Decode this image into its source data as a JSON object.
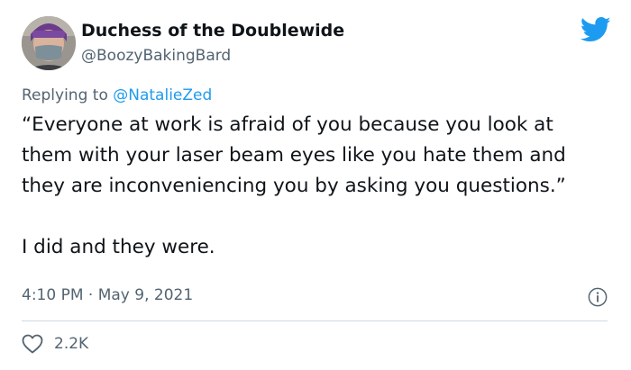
{
  "author": {
    "name": "Duchess of the Doublewide",
    "handle": "@BoozyBakingBard",
    "avatar_icon": "profile-photo"
  },
  "reply": {
    "prefix": "Replying to ",
    "to": "@NatalieZed"
  },
  "text": {
    "line1": "“Everyone at work is afraid of you because you look at them with your laser beam eyes like you hate them and they are inconveniencing you by asking you questions.”",
    "line2": "I did and they were."
  },
  "timestamp": {
    "time": "4:10 PM",
    "separator": " · ",
    "date": "May 9, 2021"
  },
  "engagement": {
    "likes": "2.2K"
  },
  "colors": {
    "brand": "#1d9bf0",
    "secondary_text": "#536471",
    "divider": "#cfd9de"
  },
  "icons": {
    "logo": "twitter-bird-icon",
    "info": "info-icon",
    "like": "heart-icon"
  }
}
